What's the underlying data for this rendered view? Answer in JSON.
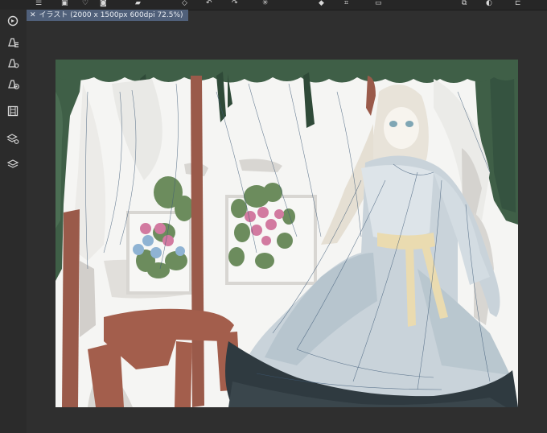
{
  "document_tab": {
    "close_symbol": "✕",
    "title": "イラスト (2000 x 1500px 600dpi 72.5%)"
  },
  "toolbar_icons": [
    "menu-icon",
    "save-icon",
    "check-icon",
    "pen-icon",
    "undo-icon",
    "redo-icon",
    "brightness-icon",
    "fill-icon",
    "transform-icon",
    "crop-icon",
    "copy-icon",
    "rotate-icon",
    "split-icon"
  ],
  "side_tools": [
    "navigator-icon",
    "brush-settings-icon",
    "tool-property-icon",
    "sub-tool-icon",
    "film-icon",
    "layer-property-icon",
    "layers-icon"
  ],
  "colors": {
    "tab_background": "#50607a",
    "curtain_green": "#3f5f47",
    "wood_brown": "#9a5a4a",
    "dress_blue": "#c9d3da",
    "sash_yellow": "#eadbb0"
  }
}
